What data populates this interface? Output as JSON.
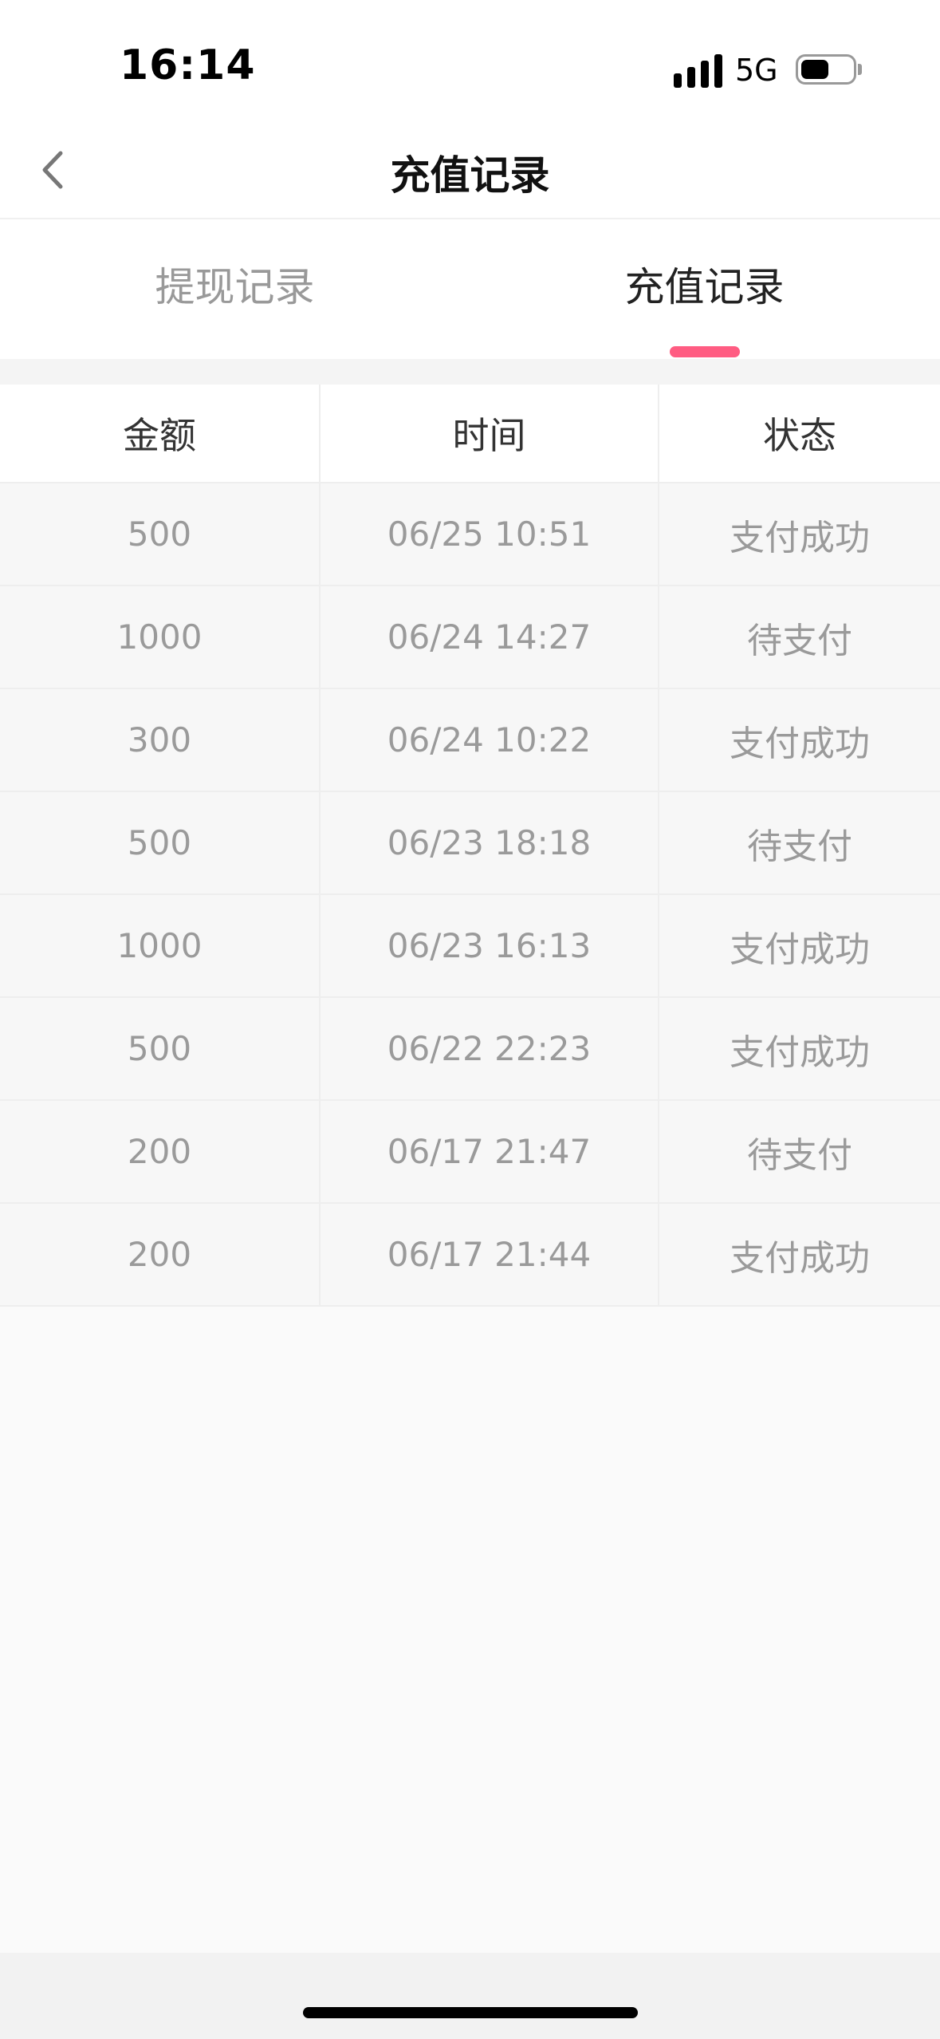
{
  "status_bar": {
    "time": "16:14",
    "network": "5G",
    "battery_level": 0.55
  },
  "nav": {
    "title": "充值记录",
    "back_icon": "chevron-left-icon"
  },
  "tabs": [
    {
      "label": "提现记录",
      "active": false
    },
    {
      "label": "充值记录",
      "active": true
    }
  ],
  "colors": {
    "accent": "#ff5c82"
  },
  "table": {
    "headers": [
      "金额",
      "时间",
      "状态"
    ],
    "rows": [
      [
        "500",
        "06/25 10:51",
        "支付成功"
      ],
      [
        "1000",
        "06/24 14:27",
        "待支付"
      ],
      [
        "300",
        "06/24 10:22",
        "支付成功"
      ],
      [
        "500",
        "06/23 18:18",
        "待支付"
      ],
      [
        "1000",
        "06/23 16:13",
        "支付成功"
      ],
      [
        "500",
        "06/22 22:23",
        "支付成功"
      ],
      [
        "200",
        "06/17 21:47",
        "待支付"
      ],
      [
        "200",
        "06/17 21:44",
        "支付成功"
      ]
    ]
  }
}
